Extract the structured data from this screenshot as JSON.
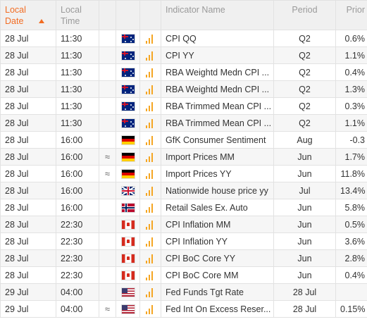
{
  "colors": {
    "accent": "#f26c22",
    "importance": "#f5a623"
  },
  "header": {
    "date_label": "Local Date",
    "time_label": "Local Time",
    "indicator_label": "Indicator Name",
    "period_label": "Period",
    "prior_label": "Prior",
    "sort_icon": "sort-up-icon"
  },
  "rows": [
    {
      "date": "28 Jul",
      "time": "11:30",
      "trend": "",
      "flag": "au",
      "flag_icon": "australia-flag-icon",
      "importance": "high",
      "name": "CPI QQ",
      "period": "Q2",
      "prior": "0.6%"
    },
    {
      "date": "28 Jul",
      "time": "11:30",
      "trend": "",
      "flag": "au",
      "flag_icon": "australia-flag-icon",
      "importance": "high",
      "name": "CPI YY",
      "period": "Q2",
      "prior": "1.1%"
    },
    {
      "date": "28 Jul",
      "time": "11:30",
      "trend": "",
      "flag": "au",
      "flag_icon": "australia-flag-icon",
      "importance": "high",
      "name": "RBA Weightd Medn CPI ...",
      "period": "Q2",
      "prior": "0.4%"
    },
    {
      "date": "28 Jul",
      "time": "11:30",
      "trend": "",
      "flag": "au",
      "flag_icon": "australia-flag-icon",
      "importance": "high",
      "name": "RBA Weightd Medn CPI ...",
      "period": "Q2",
      "prior": "1.3%"
    },
    {
      "date": "28 Jul",
      "time": "11:30",
      "trend": "",
      "flag": "au",
      "flag_icon": "australia-flag-icon",
      "importance": "high",
      "name": "RBA Trimmed Mean CPI ...",
      "period": "Q2",
      "prior": "0.3%"
    },
    {
      "date": "28 Jul",
      "time": "11:30",
      "trend": "",
      "flag": "au",
      "flag_icon": "australia-flag-icon",
      "importance": "high",
      "name": "RBA Trimmed Mean CPI ...",
      "period": "Q2",
      "prior": "1.1%"
    },
    {
      "date": "28 Jul",
      "time": "16:00",
      "trend": "",
      "flag": "de",
      "flag_icon": "germany-flag-icon",
      "importance": "high",
      "name": "GfK Consumer Sentiment",
      "period": "Aug",
      "prior": "-0.3"
    },
    {
      "date": "28 Jul",
      "time": "16:00",
      "trend": "≈",
      "flag": "de",
      "flag_icon": "germany-flag-icon",
      "importance": "high",
      "name": "Import Prices MM",
      "period": "Jun",
      "prior": "1.7%"
    },
    {
      "date": "28 Jul",
      "time": "16:00",
      "trend": "≈",
      "flag": "de",
      "flag_icon": "germany-flag-icon",
      "importance": "high",
      "name": "Import Prices YY",
      "period": "Jun",
      "prior": "11.8%"
    },
    {
      "date": "28 Jul",
      "time": "16:00",
      "trend": "",
      "flag": "gb",
      "flag_icon": "uk-flag-icon",
      "importance": "high",
      "name": "Nationwide house price yy",
      "period": "Jul",
      "prior": "13.4%"
    },
    {
      "date": "28 Jul",
      "time": "16:00",
      "trend": "",
      "flag": "no",
      "flag_icon": "norway-flag-icon",
      "importance": "high",
      "name": "Retail Sales Ex. Auto",
      "period": "Jun",
      "prior": "5.8%"
    },
    {
      "date": "28 Jul",
      "time": "22:30",
      "trend": "",
      "flag": "ca",
      "flag_icon": "canada-flag-icon",
      "importance": "high",
      "name": "CPI Inflation MM",
      "period": "Jun",
      "prior": "0.5%"
    },
    {
      "date": "28 Jul",
      "time": "22:30",
      "trend": "",
      "flag": "ca",
      "flag_icon": "canada-flag-icon",
      "importance": "high",
      "name": "CPI Inflation YY",
      "period": "Jun",
      "prior": "3.6%"
    },
    {
      "date": "28 Jul",
      "time": "22:30",
      "trend": "",
      "flag": "ca",
      "flag_icon": "canada-flag-icon",
      "importance": "high",
      "name": "CPI BoC Core YY",
      "period": "Jun",
      "prior": "2.8%"
    },
    {
      "date": "28 Jul",
      "time": "22:30",
      "trend": "",
      "flag": "ca",
      "flag_icon": "canada-flag-icon",
      "importance": "high",
      "name": "CPI BoC Core MM",
      "period": "Jun",
      "prior": "0.4%"
    },
    {
      "date": "29 Jul",
      "time": "04:00",
      "trend": "",
      "flag": "us",
      "flag_icon": "usa-flag-icon",
      "importance": "high",
      "name": "Fed Funds Tgt Rate",
      "period": "28 Jul",
      "prior": ""
    },
    {
      "date": "29 Jul",
      "time": "04:00",
      "trend": "≈",
      "flag": "us",
      "flag_icon": "usa-flag-icon",
      "importance": "high",
      "name": "Fed Int On Excess Reser...",
      "period": "28 Jul",
      "prior": "0.15%"
    }
  ]
}
